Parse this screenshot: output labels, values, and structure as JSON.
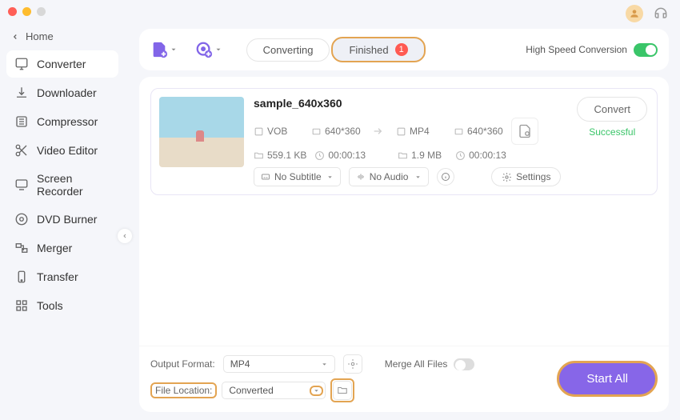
{
  "window": {
    "home": "Home"
  },
  "sidebar": {
    "items": [
      {
        "label": "Converter",
        "active": true
      },
      {
        "label": "Downloader"
      },
      {
        "label": "Compressor"
      },
      {
        "label": "Video Editor"
      },
      {
        "label": "Screen Recorder"
      },
      {
        "label": "DVD Burner"
      },
      {
        "label": "Merger"
      },
      {
        "label": "Transfer"
      },
      {
        "label": "Tools"
      }
    ]
  },
  "topbar": {
    "tab_converting": "Converting",
    "tab_finished": "Finished",
    "finished_count": "1",
    "hsc_label": "High Speed Conversion"
  },
  "file": {
    "name": "sample_640x360",
    "src_format": "VOB",
    "src_res": "640*360",
    "src_size": "559.1 KB",
    "src_dur": "00:00:13",
    "dst_format": "MP4",
    "dst_res": "640*360",
    "dst_size": "1.9 MB",
    "dst_dur": "00:00:13",
    "subtitle": "No Subtitle",
    "audio": "No Audio",
    "settings_label": "Settings",
    "convert_label": "Convert",
    "status": "Successful"
  },
  "footer": {
    "output_format_label": "Output Format:",
    "output_format": "MP4",
    "file_location_label": "File Location:",
    "file_location": "Converted",
    "merge_label": "Merge All Files",
    "start_all": "Start All"
  }
}
